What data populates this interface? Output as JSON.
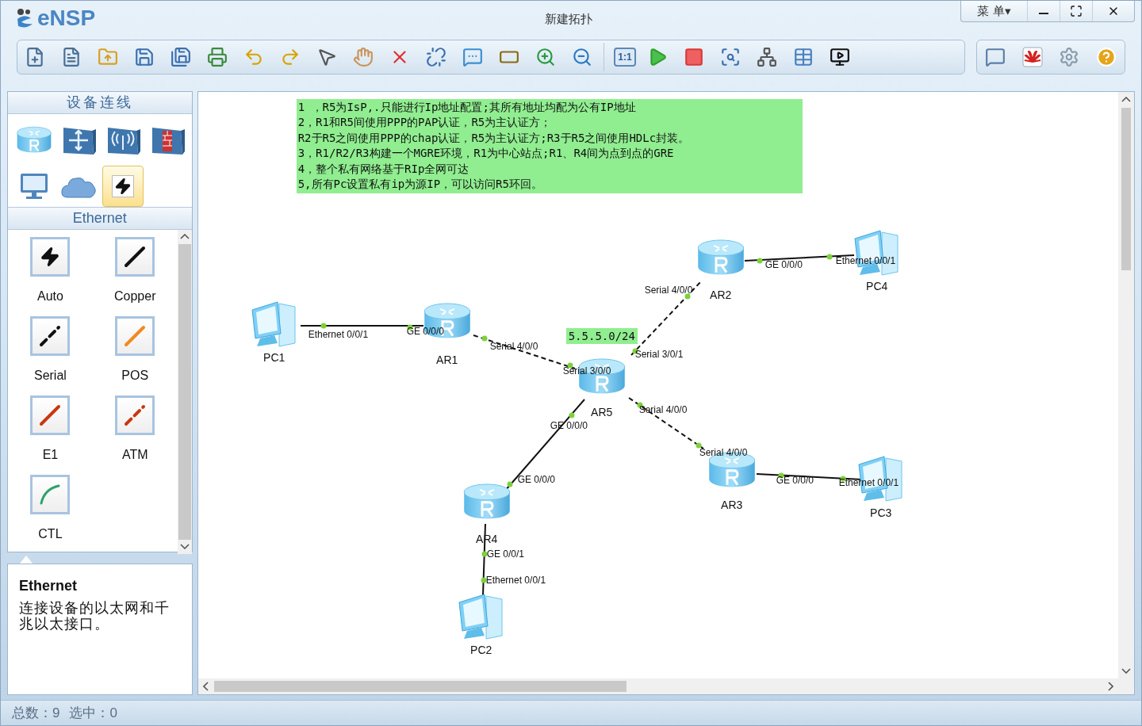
{
  "window": {
    "logo": "eNSP",
    "title": "新建拓扑",
    "menu": "菜 单▾"
  },
  "toolbar": {
    "zoom_reset": "1:1"
  },
  "panel": {
    "title": "设备连线",
    "categories": [
      {
        "kind": "router",
        "selected": false
      },
      {
        "kind": "switch",
        "selected": false
      },
      {
        "kind": "wireless",
        "selected": false
      },
      {
        "kind": "firewall",
        "selected": false
      },
      {
        "kind": "pc",
        "selected": false
      },
      {
        "kind": "cloud",
        "selected": false
      },
      {
        "kind": "link",
        "selected": true
      }
    ],
    "section": "Ethernet",
    "link_types": [
      {
        "label": "Auto",
        "kind": "auto"
      },
      {
        "label": "Copper",
        "kind": "copper"
      },
      {
        "label": "Serial",
        "kind": "serial"
      },
      {
        "label": "POS",
        "kind": "pos"
      },
      {
        "label": "E1",
        "kind": "e1"
      },
      {
        "label": "ATM",
        "kind": "atm"
      },
      {
        "label": "CTL",
        "kind": "ctl"
      }
    ],
    "description": {
      "title": "Ethernet",
      "text": "连接设备的以太网和千兆以太接口。"
    }
  },
  "canvas": {
    "note": [
      "1 ，R5为IsP,.只能进行Ip地址配置;其所有地址均配为公有IP地址",
      "2，R1和R5间使用PPP的PAP认证，R5为主认证方；",
      "R2于R5之间使用PPP的chap认证，R5为主认证方;R3于R5之间使用HDLc封装。",
      "3，R1/R2/R3构建一个MGRE环境，R1为中心站点;R1、R4间为点到点的GRE",
      "4，整个私有网络基于RIp全网可达",
      "5,所有Pc设置私有ip为源IP，可以访问R5环回。"
    ],
    "subnet_label": "5.5.5.0/24",
    "nodes": [
      {
        "name": "PC1",
        "kind": "pc"
      },
      {
        "name": "AR1",
        "kind": "router"
      },
      {
        "name": "AR5",
        "kind": "router"
      },
      {
        "name": "AR2",
        "kind": "router"
      },
      {
        "name": "PC4",
        "kind": "pc"
      },
      {
        "name": "AR3",
        "kind": "router"
      },
      {
        "name": "PC3",
        "kind": "pc"
      },
      {
        "name": "AR4",
        "kind": "router"
      },
      {
        "name": "PC2",
        "kind": "pc"
      }
    ],
    "links": [
      {
        "kind": "copper",
        "ports": [
          "Ethernet 0/0/1",
          "GE 0/0/0"
        ]
      },
      {
        "kind": "serial",
        "ports": [
          "Serial 4/0/0",
          "Serial 3/0/0"
        ]
      },
      {
        "kind": "serial",
        "ports": [
          "Serial 4/0/0",
          "Serial 3/0/1"
        ]
      },
      {
        "kind": "copper",
        "ports": [
          "GE 0/0/0",
          "Ethernet 0/0/1"
        ]
      },
      {
        "kind": "serial",
        "ports": [
          "Serial 4/0/0",
          "Serial 4/0/0"
        ]
      },
      {
        "kind": "copper",
        "ports": [
          "GE 0/0/0",
          "GE 0/0/0"
        ]
      },
      {
        "kind": "copper",
        "ports": [
          "GE 0/0/0",
          "Ethernet 0/0/1"
        ]
      },
      {
        "kind": "copper",
        "ports": [
          "GE 0/0/1",
          "Ethernet 0/0/1"
        ]
      }
    ]
  },
  "status_bar": {
    "total": "总数：9",
    "selected": "选中：0"
  }
}
